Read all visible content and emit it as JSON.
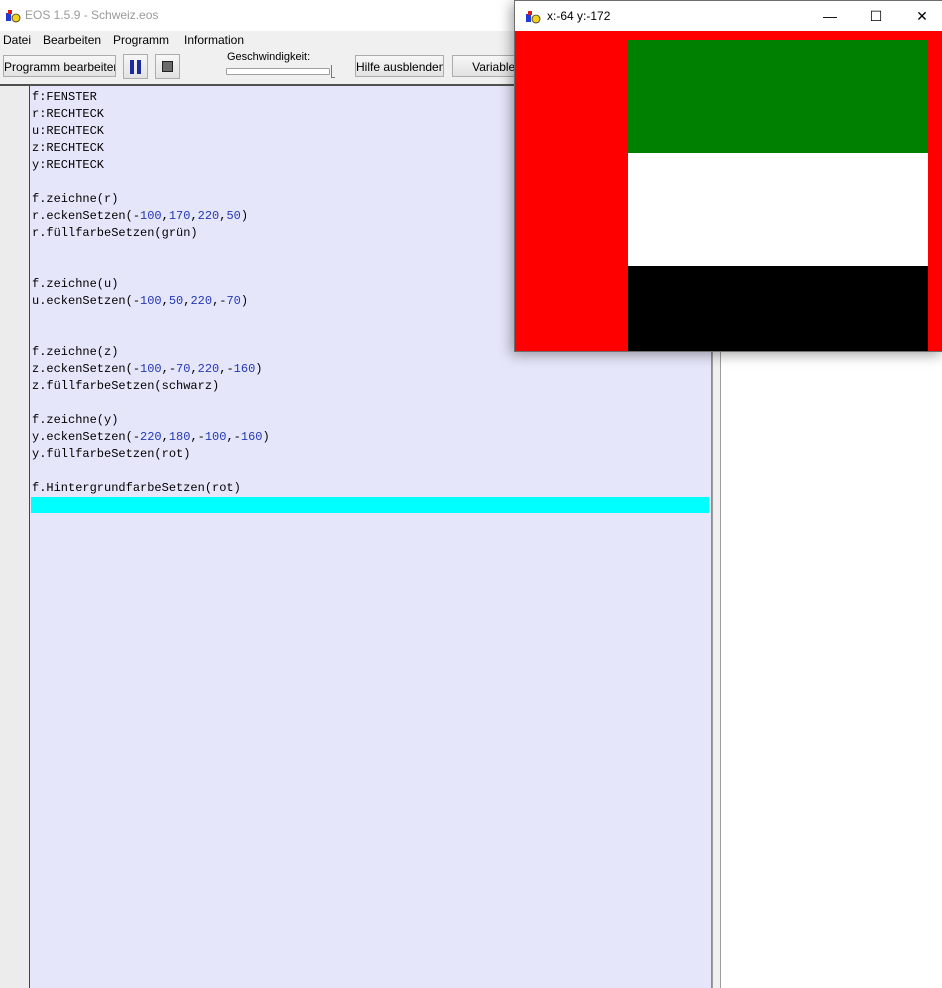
{
  "main_window": {
    "title": "EOS 1.5.9 - Schweiz.eos"
  },
  "menu": {
    "items": [
      "Datei",
      "Bearbeiten",
      "Programm",
      "Information"
    ]
  },
  "toolbar": {
    "edit_label": "Programm bearbeiten",
    "pause_icon": "pause-icon",
    "stop_icon": "stop-icon",
    "speed_label": "Geschwindigkeit:",
    "speed_level": 1.0,
    "help_label": "Hilfe ausblenden",
    "variables_label": "Variablen"
  },
  "editor": {
    "lines": [
      "f:FENSTER",
      "r:RECHTECK",
      "u:RECHTECK",
      "z:RECHTECK",
      "y:RECHTECK",
      "",
      "f.zeichne(r)",
      "r.eckenSetzen(-100,170,220,50)",
      "r.füllfarbeSetzen(grün)",
      "",
      "",
      "f.zeichne(u)",
      "u.eckenSetzen(-100,50,220,-70)",
      "",
      "",
      "f.zeichne(z)",
      "z.eckenSetzen(-100,-70,220,-160)",
      "z.füllfarbeSetzen(schwarz)",
      "",
      "f.zeichne(y)",
      "y.eckenSetzen(-220,180,-100,-160)",
      "y.füllfarbeSetzen(rot)",
      "",
      "f.HintergrundfarbeSetzen(rot)",
      ""
    ],
    "number_color": "#2438b3",
    "current_line_color": "#00ffff",
    "background_color": "#e6e6fa"
  },
  "drawing_window": {
    "title": "x:-64 y:-172",
    "minimize_icon": "minimize-icon",
    "maximize_icon": "maximize-icon",
    "close_icon": "close-icon",
    "background_color": "#ff0000",
    "rectangles": [
      {
        "name": "r",
        "corners": [
          -100,
          170,
          220,
          50
        ],
        "fill": "#008000"
      },
      {
        "name": "u",
        "corners": [
          -100,
          50,
          220,
          -70
        ],
        "fill": "#ffffff"
      },
      {
        "name": "z",
        "corners": [
          -100,
          -70,
          220,
          -160
        ],
        "fill": "#000000"
      },
      {
        "name": "y",
        "corners": [
          -220,
          180,
          -100,
          -160
        ],
        "fill": "#ff0000"
      }
    ]
  }
}
